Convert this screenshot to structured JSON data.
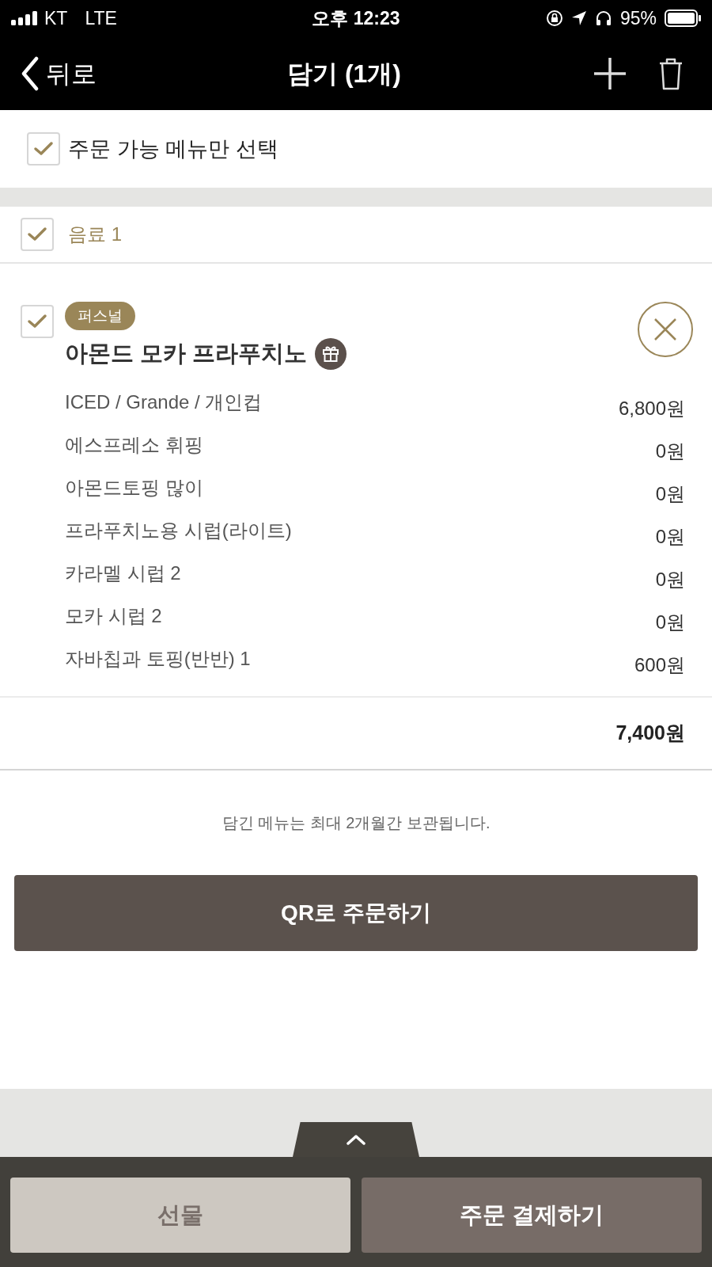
{
  "status_bar": {
    "carrier": "KT",
    "network": "LTE",
    "time": "오후 12:23",
    "battery": "95%"
  },
  "header": {
    "back": "뒤로",
    "title": "담기 (1개)"
  },
  "select_available": {
    "label": "주문 가능 메뉴만 선택",
    "checked": true
  },
  "groups": [
    {
      "label": "음료 1",
      "checked": true,
      "items": [
        {
          "checked": true,
          "badge": "퍼스널",
          "name": "아몬드 모카 프라푸치노",
          "options": [
            {
              "label": "ICED / Grande / 개인컵",
              "price": "6,800원"
            },
            {
              "label": "에스프레소 휘핑",
              "price": "0원"
            },
            {
              "label": "아몬드토핑 많이",
              "price": "0원"
            },
            {
              "label": "프라푸치노용 시럽(라이트)",
              "price": "0원"
            },
            {
              "label": "카라멜 시럽 2",
              "price": "0원"
            },
            {
              "label": "모카 시럽 2",
              "price": "0원"
            },
            {
              "label": "자바칩과 토핑(반반) 1",
              "price": "600원"
            }
          ],
          "total": "7,400원"
        }
      ]
    }
  ],
  "note": "담긴 메뉴는 최대 2개월간 보관됩니다.",
  "qr_button": "QR로 주문하기",
  "bottom": {
    "gift_button": "선물",
    "order_button": "주문 결제하기"
  }
}
